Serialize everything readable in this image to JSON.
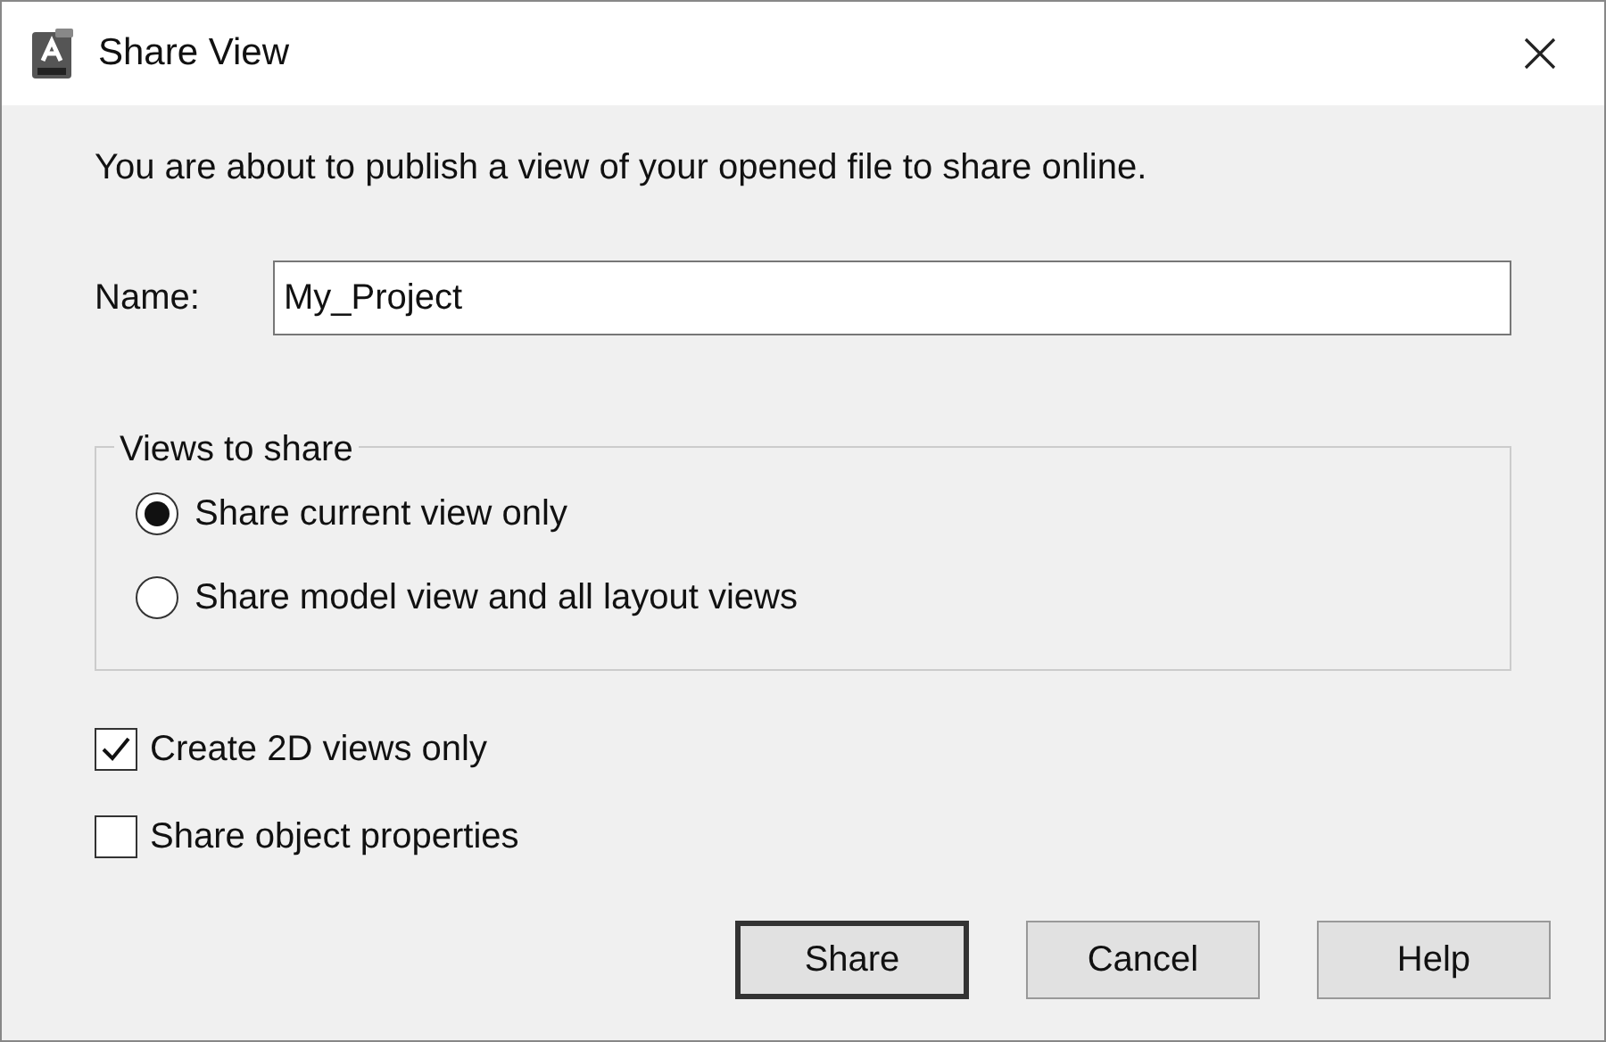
{
  "window": {
    "title": "Share View"
  },
  "intro": "You are about to publish a view of your opened file to share online.",
  "name_field": {
    "label": "Name:",
    "value": "My_Project"
  },
  "views_group": {
    "title": "Views to share",
    "options": [
      {
        "label": "Share current view only",
        "selected": true
      },
      {
        "label": "Share model view and all layout views",
        "selected": false
      }
    ]
  },
  "checkboxes": [
    {
      "label": "Create 2D views only",
      "checked": true
    },
    {
      "label": "Share object properties",
      "checked": false
    }
  ],
  "buttons": [
    {
      "label": "Share",
      "default": true
    },
    {
      "label": "Cancel",
      "default": false
    },
    {
      "label": "Help",
      "default": false
    }
  ]
}
